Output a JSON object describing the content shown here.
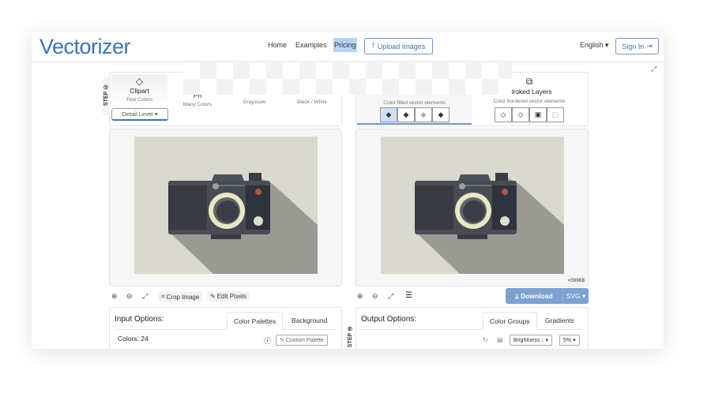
{
  "header": {
    "logo": "Vectorizer",
    "nav": [
      "Home",
      "Examples",
      "Pricing"
    ],
    "upload_label": "Upload Images",
    "language": "English",
    "sign_in": "Sign In"
  },
  "input_modes": {
    "step_label": "STEP ①",
    "items": [
      {
        "title": "Clipart",
        "sub": "Few Colors"
      },
      {
        "title": "Ph",
        "sub": "Many Colors"
      },
      {
        "title": "",
        "sub": "Grayscale"
      },
      {
        "title": "",
        "sub": "Black / White"
      }
    ],
    "detail_level": "Detail Level"
  },
  "output_modes": {
    "items": [
      {
        "title": "",
        "sub": "Color filled vector elements"
      },
      {
        "title": "Stroked Layers",
        "sub": "Color bordered vector elements"
      }
    ]
  },
  "output_preview": {
    "file_size": "≈389KB"
  },
  "left_tools": {
    "crop": "Crop Image",
    "edit": "Edit Pixels"
  },
  "right_tools": {
    "download": "Download",
    "format": "SVG"
  },
  "input_options": {
    "title": "Input Options:",
    "tabs": [
      "Color Palettes",
      "Background"
    ],
    "colors": "Colors: 24",
    "custom_palette": "Custom Palette"
  },
  "output_options": {
    "step_label": "STEP ③",
    "title": "Output Options:",
    "tabs": [
      "Color Groups",
      "Gradients"
    ],
    "sort": "Brightness ↓",
    "threshold": "5%"
  },
  "colors": {
    "accent": "#3f72b5",
    "download_bg": "#7ea1d0",
    "image_bg": "#d9d9cd",
    "shadow": "#9a9a94"
  }
}
